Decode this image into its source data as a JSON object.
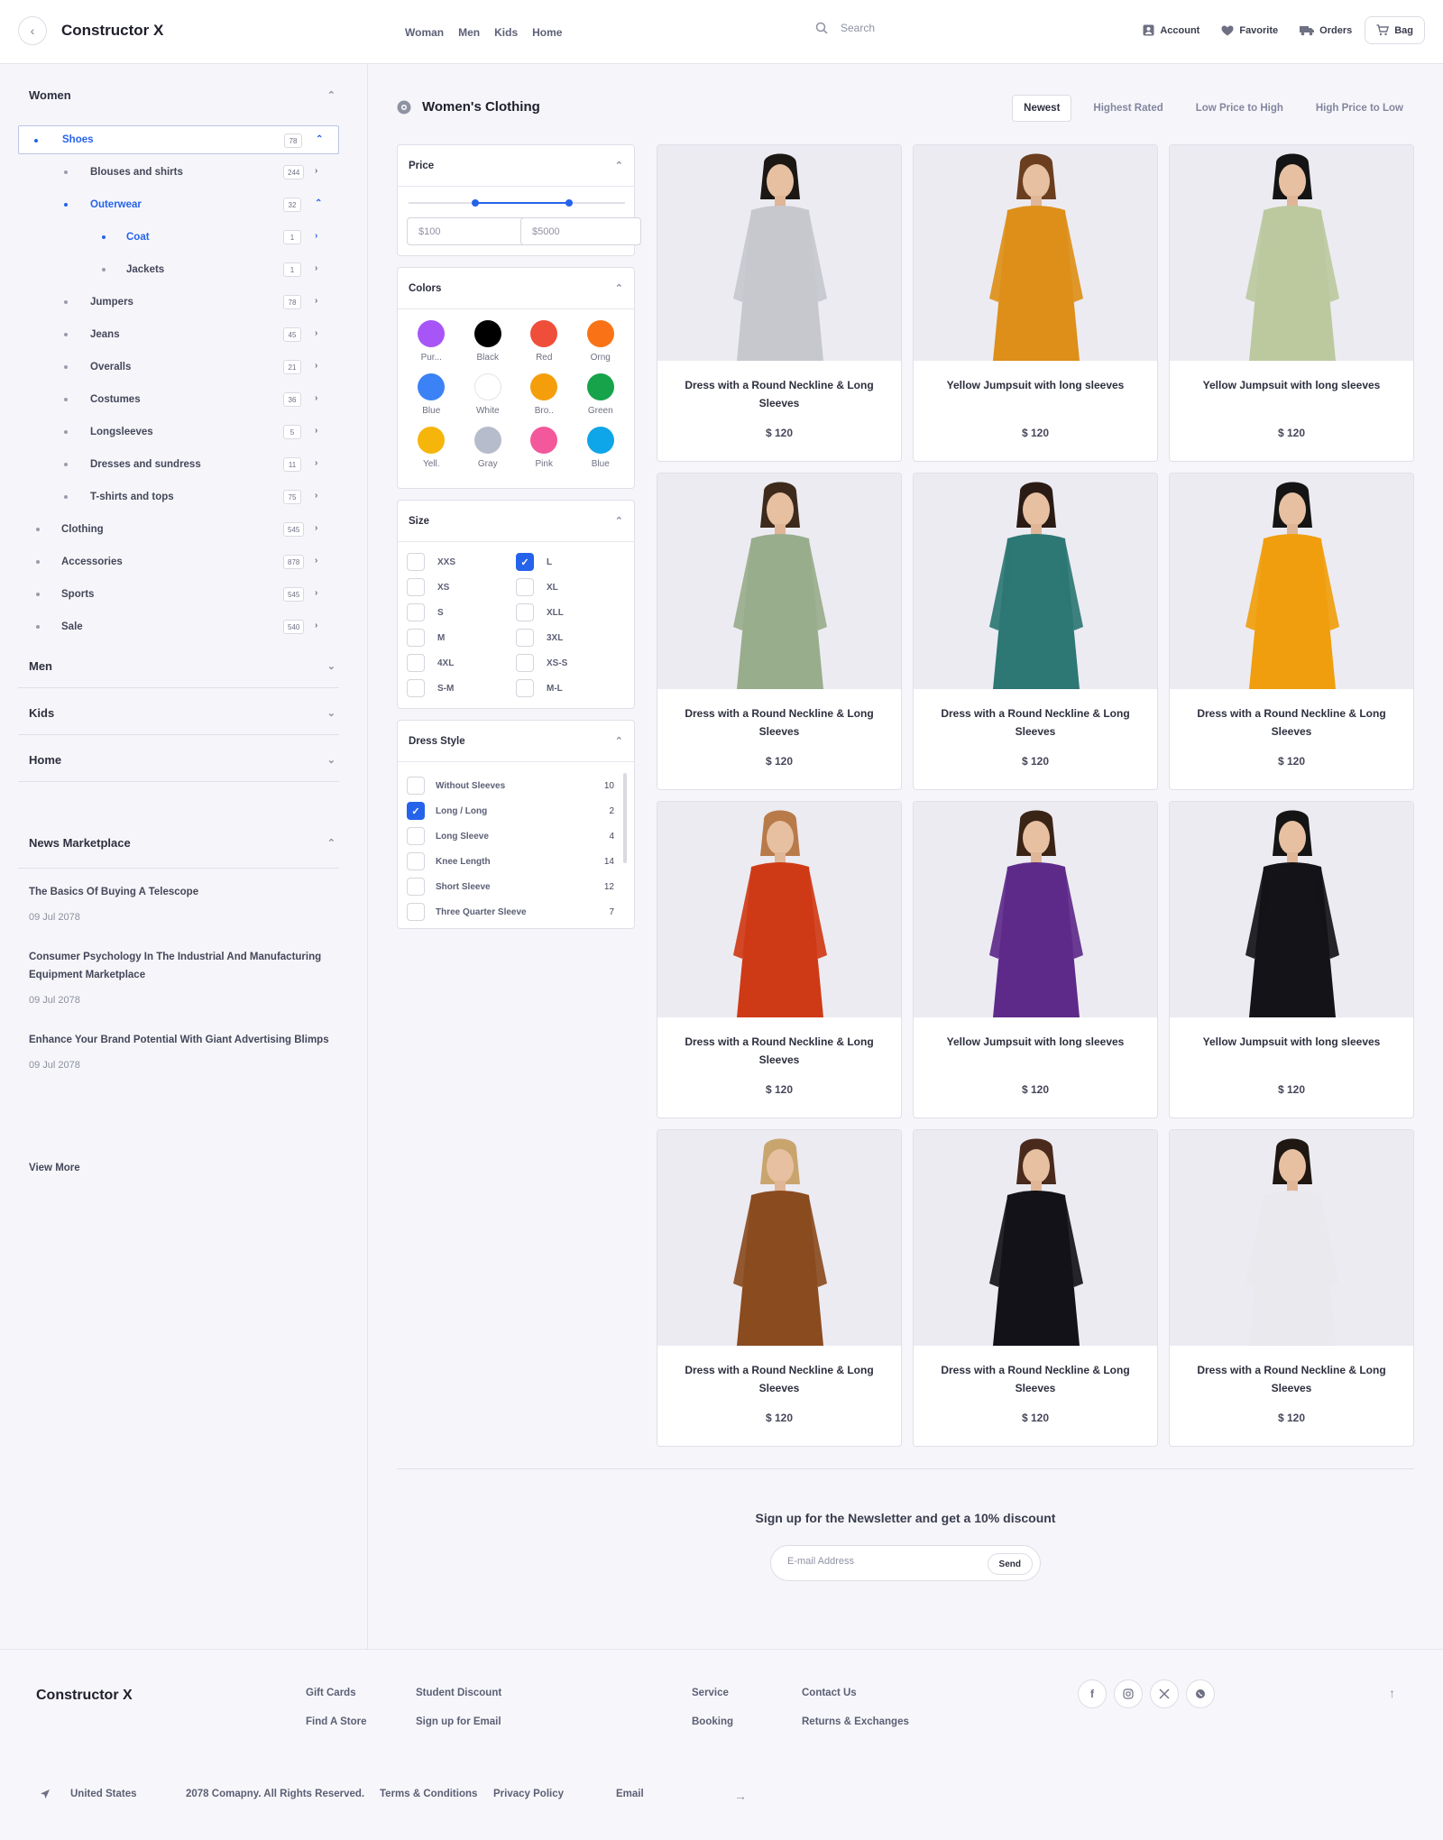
{
  "header": {
    "brand": "Constructor X",
    "nav": [
      "Woman",
      "Men",
      "Kids",
      "Home"
    ],
    "search_placeholder": "Search",
    "account": "Account",
    "favorite": "Favorite",
    "orders": "Orders",
    "bag": "Bag"
  },
  "sidebar": {
    "women_title": "Women",
    "categories": [
      {
        "label": "Shoes",
        "count": "78"
      },
      {
        "label": "Blouses and shirts",
        "count": "244"
      },
      {
        "label": "Outerwear",
        "count": "32"
      },
      {
        "label": "Coat",
        "count": "1"
      },
      {
        "label": "Jackets",
        "count": "1"
      },
      {
        "label": "Jumpers",
        "count": "78"
      },
      {
        "label": "Jeans",
        "count": "45"
      },
      {
        "label": "Overalls",
        "count": "21"
      },
      {
        "label": "Costumes",
        "count": "36"
      },
      {
        "label": "Longsleeves",
        "count": "5"
      },
      {
        "label": "Dresses and sundress",
        "count": "11"
      },
      {
        "label": "T-shirts and tops",
        "count": "75"
      },
      {
        "label": "Clothing",
        "count": "545"
      },
      {
        "label": "Accessories",
        "count": "878"
      },
      {
        "label": "Sports",
        "count": "545"
      },
      {
        "label": "Sale",
        "count": "540"
      }
    ],
    "men_title": "Men",
    "kids_title": "Kids",
    "home_title": "Home",
    "news_title": "News Marketplace",
    "news": [
      {
        "title": "The Basics Of Buying A Telescope",
        "date": "09 Jul 2078"
      },
      {
        "title": "Consumer Psychology In The Industrial And Manufacturing Equipment Marketplace",
        "date": "09 Jul 2078"
      },
      {
        "title": "Enhance Your Brand Potential With Giant Advertising Blimps",
        "date": "09 Jul 2078"
      }
    ],
    "view_more": "View More"
  },
  "main": {
    "title": "Women's Clothing",
    "sort": [
      "Newest",
      "Highest Rated",
      "Low Price to High",
      "High Price to Low"
    ],
    "sort_selected": "Newest"
  },
  "filters": {
    "price_title": "Price",
    "price_min": "$100",
    "price_max": "$5000",
    "price_range_fraction": [
      0.31,
      0.74
    ],
    "colors_title": "Colors",
    "colors": [
      {
        "label": "Pur...",
        "hex": "#a855f7"
      },
      {
        "label": "Black",
        "hex": "#000000"
      },
      {
        "label": "Red",
        "hex": "#ef4e3a"
      },
      {
        "label": "Orng",
        "hex": "#f97316"
      },
      {
        "label": "Blue",
        "hex": "#3b82f6"
      },
      {
        "label": "White",
        "hex": "#ffffff"
      },
      {
        "label": "Bro..",
        "hex": "#f59e0b"
      },
      {
        "label": "Green",
        "hex": "#16a34a"
      },
      {
        "label": "Yell.",
        "hex": "#f5b50a"
      },
      {
        "label": "Gray",
        "hex": "#b6bccb"
      },
      {
        "label": "Pink",
        "hex": "#f2589b"
      },
      {
        "label": "Blue",
        "hex": "#0ea5e9"
      }
    ],
    "size_title": "Size",
    "sizes": [
      {
        "label": "XXS",
        "checked": false
      },
      {
        "label": "L",
        "checked": true
      },
      {
        "label": "XS",
        "checked": false
      },
      {
        "label": "XL",
        "checked": false
      },
      {
        "label": "S",
        "checked": false
      },
      {
        "label": "XLL",
        "checked": false
      },
      {
        "label": "M",
        "checked": false
      },
      {
        "label": "3XL",
        "checked": false
      },
      {
        "label": "4XL",
        "checked": false
      },
      {
        "label": "XS-S",
        "checked": false
      },
      {
        "label": "S-M",
        "checked": false
      },
      {
        "label": "M-L",
        "checked": false
      }
    ],
    "style_title": "Dress Style",
    "styles": [
      {
        "label": "Without Sleeves",
        "count": "10",
        "checked": false
      },
      {
        "label": "Long / Long",
        "count": "2",
        "checked": true
      },
      {
        "label": "Long Sleeve",
        "count": "4",
        "checked": false
      },
      {
        "label": "Knee Length",
        "count": "14",
        "checked": false
      },
      {
        "label": "Short Sleeve",
        "count": "12",
        "checked": false
      },
      {
        "label": "Three Quarter Sleeve",
        "count": "7",
        "checked": false
      }
    ]
  },
  "products": [
    {
      "name": "Dress with a Round Neckline & Long Sleeves",
      "price": "$ 120",
      "color": "#c6c8ce",
      "hair": "#1c1713"
    },
    {
      "name": "Yellow Jumpsuit with long sleeves",
      "price": "$ 120",
      "color": "#dd8f19",
      "hair": "#6b3e1f"
    },
    {
      "name": "Yellow Jumpsuit with long sleeves",
      "price": "$ 120",
      "color": "#bcc99f",
      "hair": "#141414"
    },
    {
      "name": "Dress with a Round Neckline & Long Sleeves",
      "price": "$ 120",
      "color": "#98ad8c",
      "hair": "#3e2a1c"
    },
    {
      "name": "Dress with a Round Neckline & Long Sleeves",
      "price": "$ 120",
      "color": "#2d7774",
      "hair": "#2a1c14"
    },
    {
      "name": "Dress with a Round Neckline & Long Sleeves",
      "price": "$ 120",
      "color": "#f09e0d",
      "hair": "#141414"
    },
    {
      "name": "Dress with a Round Neckline & Long Sleeves",
      "price": "$ 120",
      "color": "#cf3a16",
      "hair": "#b97a4a"
    },
    {
      "name": "Yellow Jumpsuit with long sleeves",
      "price": "$ 120",
      "color": "#5e2a8a",
      "hair": "#3a2416"
    },
    {
      "name": "Yellow Jumpsuit with long sleeves",
      "price": "$ 120",
      "color": "#141418",
      "hair": "#141414"
    },
    {
      "name": "Dress with a Round Neckline & Long Sleeves",
      "price": "$ 120",
      "color": "#8a4b1f",
      "hair": "#c9a56e"
    },
    {
      "name": "Dress with a Round Neckline & Long Sleeves",
      "price": "$ 120",
      "color": "#121218",
      "hair": "#4a2a1c"
    },
    {
      "name": "Dress with a Round Neckline & Long Sleeves",
      "price": "$ 120",
      "color": "#e9e9ee",
      "hair": "#1e1712"
    }
  ],
  "newsletter": {
    "title": "Sign up for the Newsletter and get a 10% discount",
    "placeholder": "E-mail Address",
    "send": "Send"
  },
  "footer": {
    "brand": "Constructor X",
    "links": [
      "Gift Cards",
      "Student Discount",
      "Find A Store",
      "Sign up for Email",
      "Service",
      "Contact Us",
      "Booking",
      "Returns & Exchanges"
    ],
    "country": "United States",
    "copyright": "2078 Comapny. All Rights Reserved.",
    "terms": "Terms & Conditions",
    "privacy": "Privacy Policy",
    "email_label": "Email"
  }
}
